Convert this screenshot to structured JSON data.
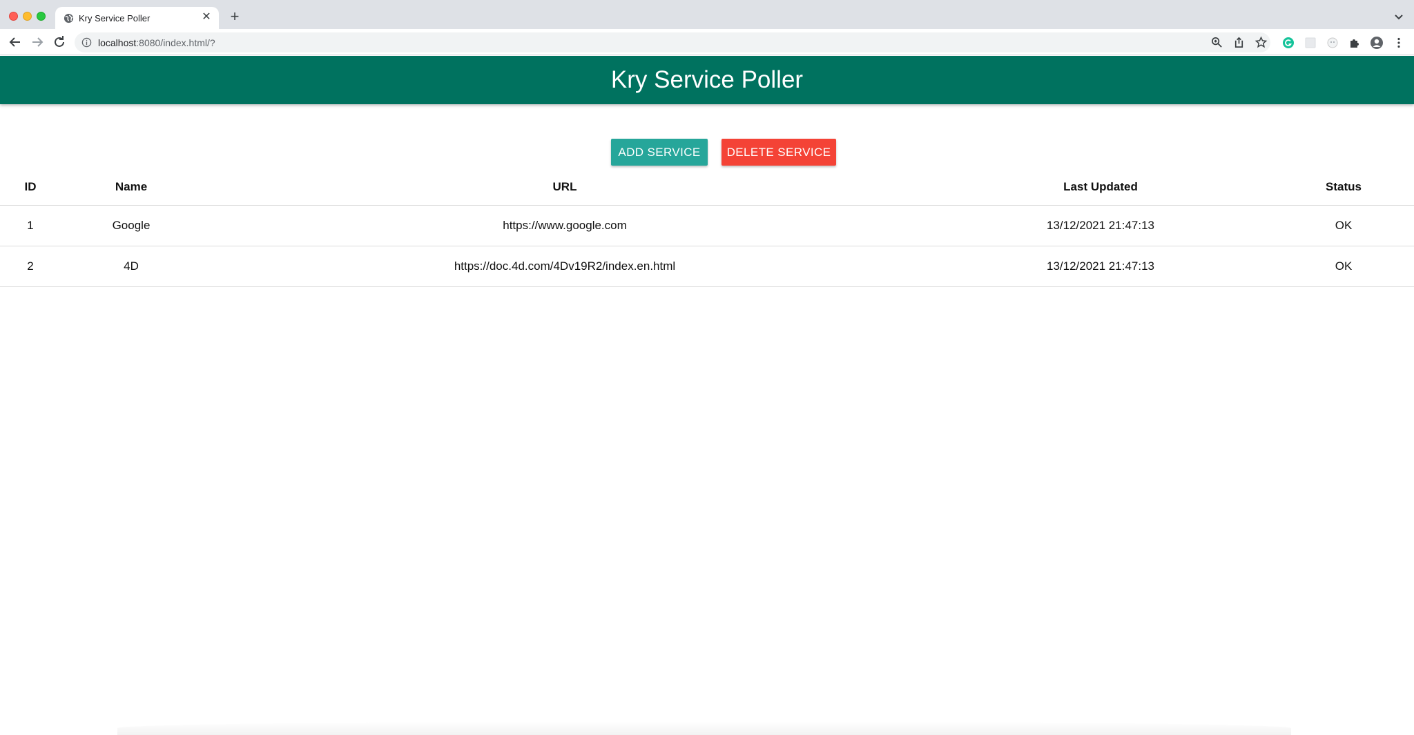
{
  "browser": {
    "tab": {
      "title": "Kry Service Poller"
    },
    "address_bar": {
      "host": "localhost",
      "path": ":8080/index.html/?"
    }
  },
  "page": {
    "title": "Kry Service Poller",
    "buttons": {
      "add": "ADD SERVICE",
      "delete": "DELETE SERVICE"
    },
    "table": {
      "headers": {
        "id": "ID",
        "name": "Name",
        "url": "URL",
        "last_updated": "Last Updated",
        "status": "Status"
      },
      "rows": [
        {
          "id": "1",
          "name": "Google",
          "url": "https://www.google.com",
          "last_updated": "13/12/2021 21:47:13",
          "status": "OK"
        },
        {
          "id": "2",
          "name": "4D",
          "url": "https://doc.4d.com/4Dv19R2/index.en.html",
          "last_updated": "13/12/2021 21:47:13",
          "status": "OK"
        }
      ]
    }
  },
  "colors": {
    "header": "#00725f",
    "add_button": "#26a69a",
    "delete_button": "#f44336"
  },
  "icons": [
    "globe-icon",
    "close-icon",
    "plus-icon",
    "chevron-down-icon",
    "back-arrow-icon",
    "forward-arrow-icon",
    "reload-icon",
    "info-icon",
    "zoom-icon",
    "share-icon",
    "star-icon",
    "grammarly-icon",
    "extension-icon",
    "puzzle-icon",
    "profile-icon",
    "kebab-menu-icon"
  ]
}
